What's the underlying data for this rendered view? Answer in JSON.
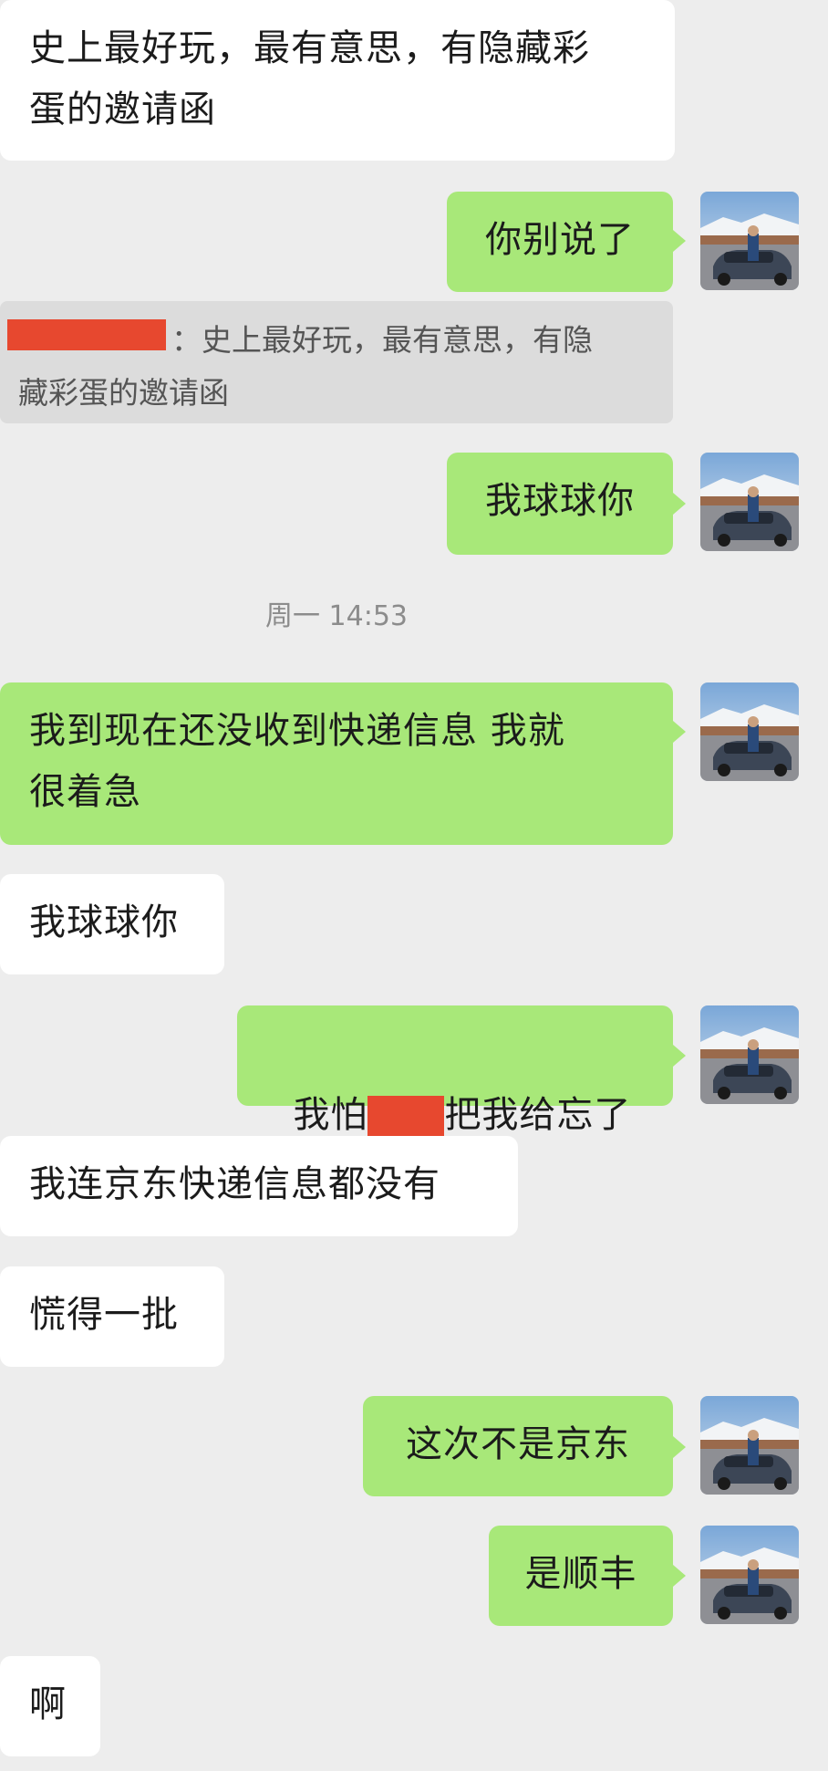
{
  "messages": [
    {
      "side": "left",
      "text": "史上最好玩，最有意思，有隐藏彩\n蛋的邀请函"
    },
    {
      "side": "right",
      "text": "你别说了"
    },
    {
      "type": "quote",
      "text": "：史上最好玩，最有意思，有隐\n藏彩蛋的邀请函"
    },
    {
      "side": "right",
      "text": "我球球你"
    },
    {
      "type": "time",
      "text": "周一 14:53"
    },
    {
      "side": "right",
      "text": "我到现在还没收到快递信息 我就\n很着急"
    },
    {
      "side": "left",
      "text": "我球球你"
    },
    {
      "side": "right",
      "text_a": "我怕",
      "text_b": "把我给忘了"
    },
    {
      "side": "left",
      "text": "我连京东快递信息都没有"
    },
    {
      "side": "left",
      "text": "慌得一批"
    },
    {
      "side": "right",
      "text": "这次不是京东"
    },
    {
      "side": "right",
      "text": "是顺丰"
    },
    {
      "side": "left",
      "text": "啊"
    }
  ],
  "colors": {
    "background": "#ededed",
    "right_bubble": "#a8e879",
    "left_bubble": "#ffffff",
    "redaction": "#e7482f"
  },
  "icons": {
    "avatar": "user-avatar-car-photo"
  }
}
